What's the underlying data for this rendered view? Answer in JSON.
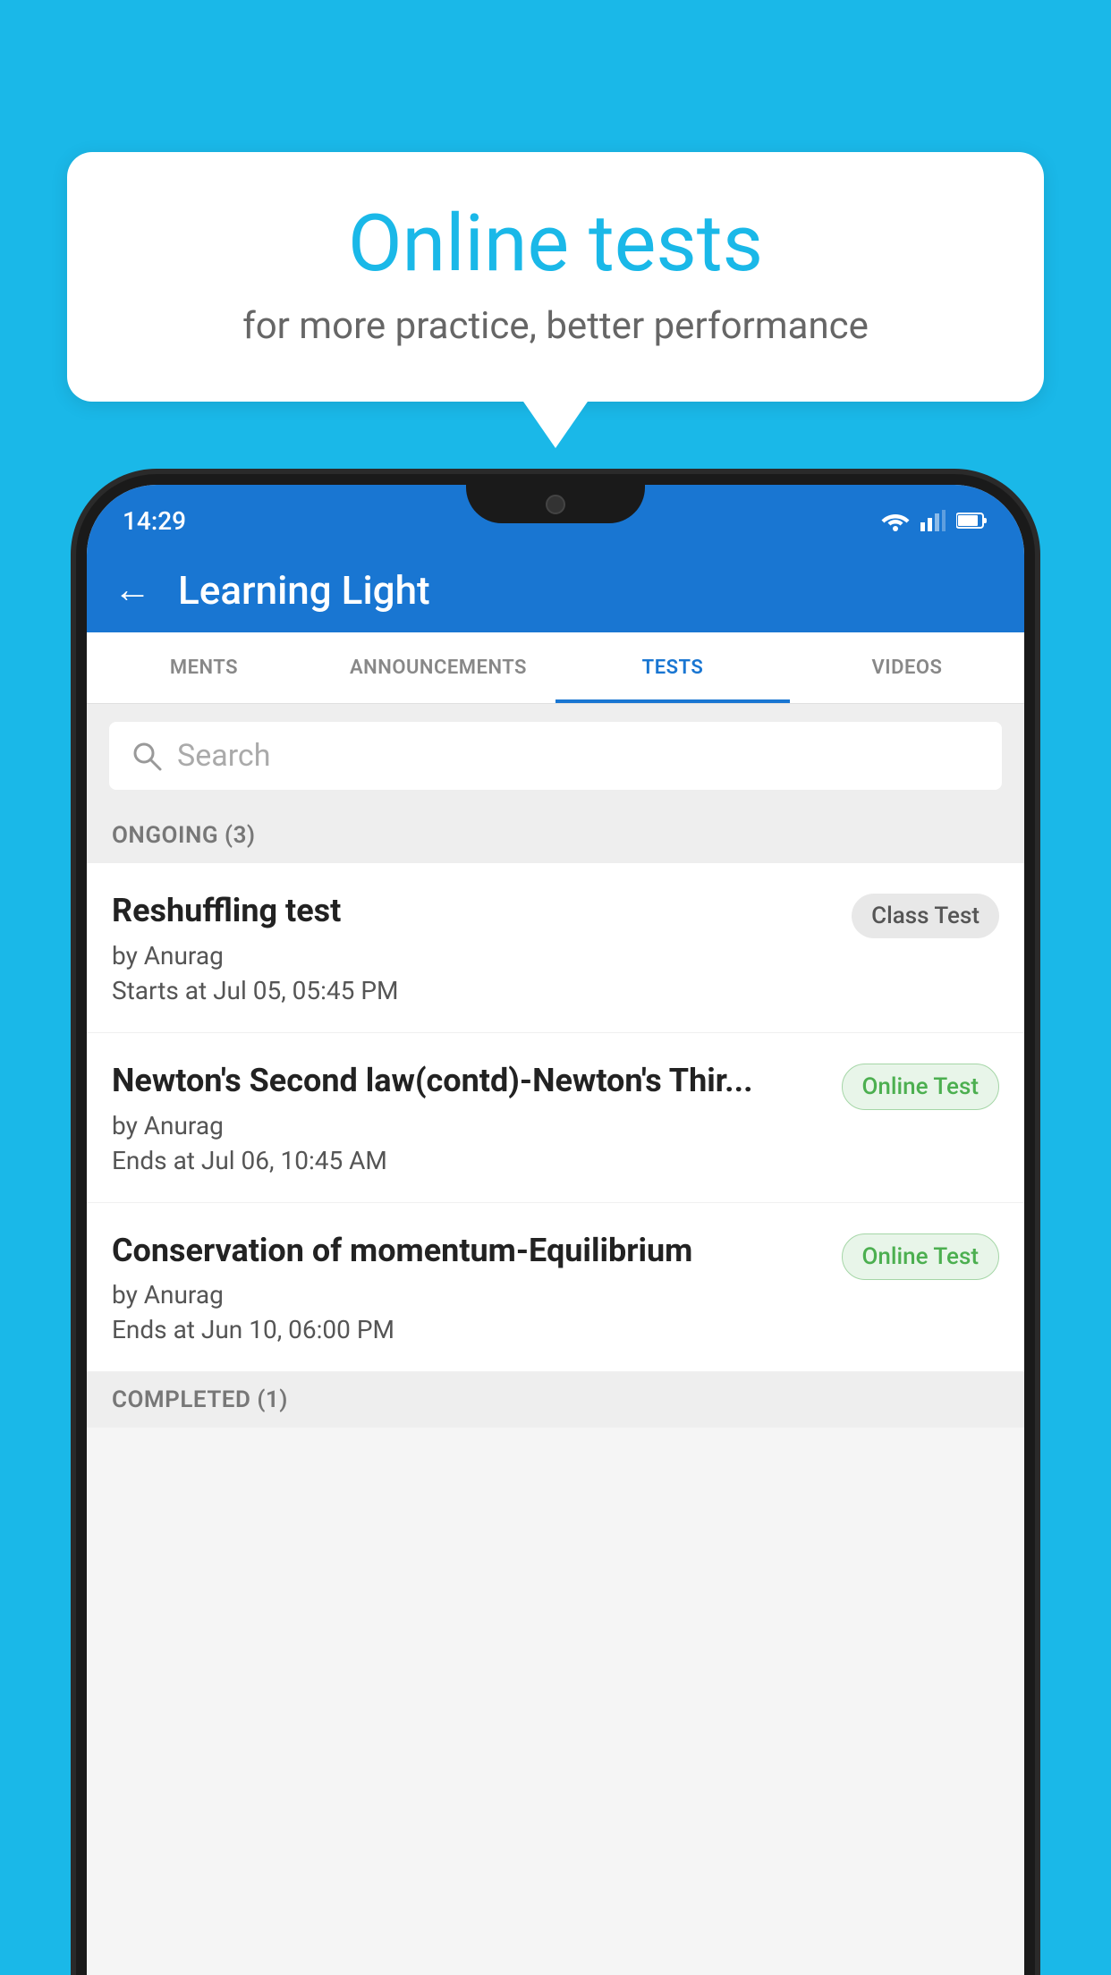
{
  "background_color": "#1AB8E8",
  "bubble": {
    "title": "Online tests",
    "subtitle": "for more practice, better performance"
  },
  "phone": {
    "status_bar": {
      "time": "14:29",
      "icons": [
        "wifi",
        "signal",
        "battery"
      ]
    },
    "header": {
      "back_label": "←",
      "title": "Learning Light"
    },
    "tabs": [
      {
        "label": "MENTS",
        "active": false
      },
      {
        "label": "ANNOUNCEMENTS",
        "active": false
      },
      {
        "label": "TESTS",
        "active": true
      },
      {
        "label": "VIDEOS",
        "active": false
      }
    ],
    "search": {
      "placeholder": "Search"
    },
    "ongoing_section": {
      "label": "ONGOING (3)"
    },
    "tests": [
      {
        "name": "Reshuffling test",
        "author": "by Anurag",
        "date_label": "Starts at",
        "date": "Jul 05, 05:45 PM",
        "badge": "Class Test",
        "badge_type": "class"
      },
      {
        "name": "Newton's Second law(contd)-Newton's Thir...",
        "author": "by Anurag",
        "date_label": "Ends at",
        "date": "Jul 06, 10:45 AM",
        "badge": "Online Test",
        "badge_type": "online"
      },
      {
        "name": "Conservation of momentum-Equilibrium",
        "author": "by Anurag",
        "date_label": "Ends at",
        "date": "Jun 10, 06:00 PM",
        "badge": "Online Test",
        "badge_type": "online"
      }
    ],
    "completed_section": {
      "label": "COMPLETED (1)"
    }
  }
}
